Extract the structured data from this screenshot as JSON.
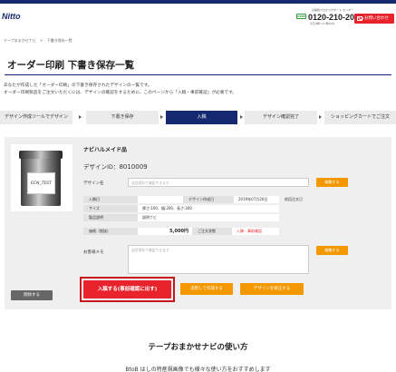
{
  "header": {
    "logo": "Nitto",
    "small_text": "お客様プロセスサポート センター",
    "freedial_label": "FREE",
    "phone": "0120-210-207",
    "hours": "平日9時〜17時30分",
    "contact_button": "お問い合わせ"
  },
  "breadcrumb": [
    "テープおまかせナビ",
    ">",
    "下書き保存一覧"
  ],
  "page": {
    "title": "オーダー印刷 下書き保存一覧",
    "intro_line1": "あなたが作成した「オーダー印刷」の下書き保存されたデザインの一覧です。",
    "intro_line2": "オーダー印刷製品をご注文いただくには、デザインの確認をするために、このページから「入稿・事前確認」が必要です。"
  },
  "steps": [
    "デザイン作成ツールでデザイン",
    "下書き保存",
    "入稿",
    "デザイン確認完了",
    "ショッピングカートでご注文"
  ],
  "item": {
    "name": "ナビハルメイド品",
    "design_id_label": "デザインID：",
    "design_id": "8010009",
    "can_label": "ECN_TEST",
    "design_name_label": "デザイン名",
    "design_name_placeholder": "送信保存で確認できます",
    "save_button": "編集する",
    "table": {
      "submit_date_key": "入稿日",
      "submit_date_val": "",
      "created_key": "デザイン作成日",
      "created_val": "2019年07月26日",
      "prev_label": "前回注文日",
      "size_key": "サイズ",
      "size_val": "厚さ:100、幅:200、長さ:300",
      "product_key": "製品説明",
      "product_val": "説明ナビ",
      "price_key": "価格（税抜）",
      "price_val": "5,000円",
      "status_key": "ご注文状態",
      "status_val": "入稿・事前確認"
    },
    "memo_label": "お客様メモ",
    "memo_placeholder": "送信保存で確認できます",
    "memo_button": "編集する"
  },
  "actions": {
    "delete": "削除する",
    "submit": "入稿する(事前確認に出す)",
    "copy": "流用して作成する",
    "edit": "デザインを修正する"
  },
  "footer": {
    "section_title": "テープおまかせナビの使い方",
    "cut_text": "BtoB はしの特産規画像でも様々な使い方をおすすめします"
  }
}
